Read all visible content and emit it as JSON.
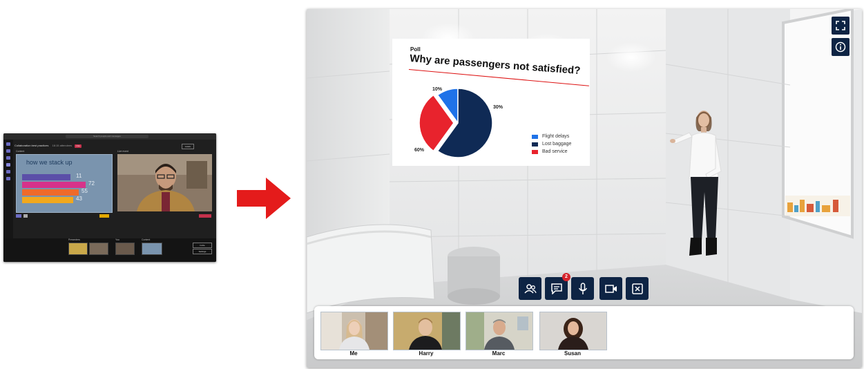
{
  "teams_thumbnail": {
    "search_placeholder": "Search people and messages",
    "meeting_title": "Collaboration best practices",
    "meeting_meta": "18:15 attendees",
    "live_badge": "Live",
    "leave_label": "Leave",
    "left_panel_label": "Content",
    "right_panel_label": "Live event",
    "slide_title": "how we stack up",
    "slide_numbers": [
      "11",
      "72",
      "55",
      "43"
    ],
    "tray_sections": [
      "Presenters",
      "You",
      "Content"
    ],
    "tray_buttons": [
      "Invite",
      "Settings"
    ]
  },
  "poll": {
    "label": "Poll",
    "question": "Why are passengers not satisfied?",
    "chart_data": {
      "type": "pie",
      "categories": [
        "Flight delays",
        "Lost baggage",
        "Bad service"
      ],
      "values": [
        10,
        60,
        30
      ],
      "labels": [
        "10%",
        "60%",
        "30%"
      ],
      "colors": [
        "#1f72e8",
        "#0f2a55",
        "#e8232d"
      ]
    }
  },
  "controls": {
    "participants_icon": "participants-icon",
    "chat_icon": "chat-icon",
    "chat_badge": "2",
    "mic_icon": "microphone-icon",
    "camera_icon": "camera-icon",
    "exit_icon": "close-box-icon",
    "fullscreen_icon": "fullscreen-icon",
    "info_icon": "info-icon"
  },
  "participants": [
    {
      "name": "Me"
    },
    {
      "name": "Harry"
    },
    {
      "name": "Marc"
    },
    {
      "name": "Susan"
    }
  ],
  "colors": {
    "button_bg": "#0e2444",
    "arrow": "#e41b1b",
    "badge": "#d6232b"
  }
}
